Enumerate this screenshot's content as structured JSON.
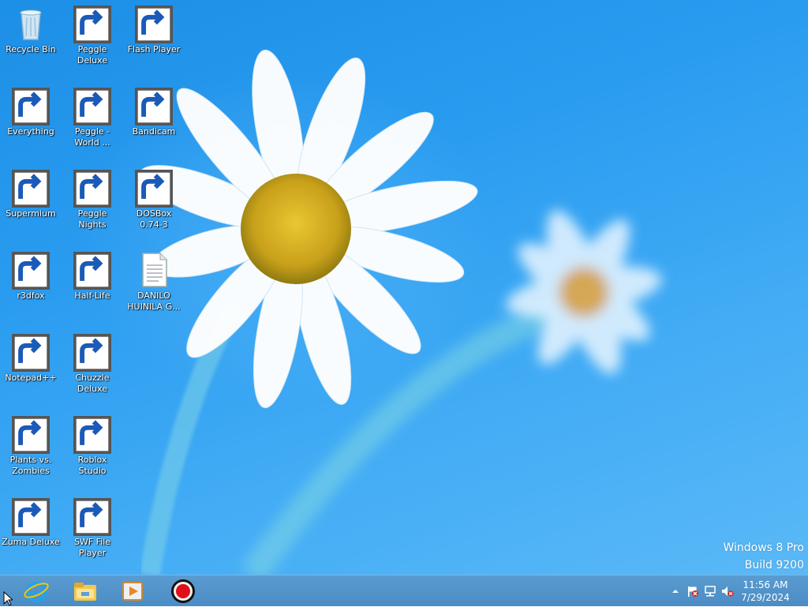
{
  "desktop": {
    "icons": [
      {
        "label": "Recycle Bin",
        "icon": "recycle-bin-icon",
        "shortcut": false
      },
      {
        "label": "Peggle Deluxe",
        "icon": "peggle-deluxe-icon",
        "shortcut": true
      },
      {
        "label": "Flash Player",
        "icon": "flash-player-icon",
        "shortcut": true
      },
      {
        "label": "Everything",
        "icon": "everything-icon",
        "shortcut": true
      },
      {
        "label": "Peggle - World ...",
        "icon": "peggle-world-icon",
        "shortcut": true
      },
      {
        "label": "Bandicam",
        "icon": "bandicam-icon",
        "shortcut": true
      },
      {
        "label": "Supermium",
        "icon": "supermium-icon",
        "shortcut": true
      },
      {
        "label": "Peggle Nights",
        "icon": "peggle-nights-icon",
        "shortcut": true
      },
      {
        "label": "DOSBox 0.74-3",
        "icon": "dosbox-icon",
        "shortcut": true
      },
      {
        "label": "r3dfox",
        "icon": "r3dfox-icon",
        "shortcut": true
      },
      {
        "label": "Half-Life",
        "icon": "half-life-icon",
        "shortcut": true
      },
      {
        "label": "DANILO HUINILA G...",
        "icon": "text-document-icon",
        "shortcut": false
      },
      {
        "label": "Notepad++",
        "icon": "notepad-plus-plus-icon",
        "shortcut": true
      },
      {
        "label": "Chuzzle Deluxe",
        "icon": "chuzzle-deluxe-icon",
        "shortcut": true
      },
      {
        "label": "Plants vs. Zombies",
        "icon": "plants-vs-zombies-icon",
        "shortcut": true
      },
      {
        "label": "Roblox Studio",
        "icon": "roblox-studio-icon",
        "shortcut": true
      },
      {
        "label": "Zuma Deluxe",
        "icon": "zuma-deluxe-icon",
        "shortcut": true
      },
      {
        "label": "SWF File Player",
        "icon": "swf-file-player-icon",
        "shortcut": true
      }
    ]
  },
  "watermark": {
    "line1": "Windows 8 Pro",
    "line2": "Build 9200"
  },
  "taskbar": {
    "pinned": [
      {
        "icon": "internet-explorer-icon"
      },
      {
        "icon": "file-explorer-icon"
      },
      {
        "icon": "media-player-icon"
      },
      {
        "icon": "bandicam-record-icon"
      }
    ],
    "tray": {
      "icons": [
        "show-hidden-icons-chevron",
        "action-center-flag-icon",
        "network-icon",
        "volume-muted-icon"
      ],
      "time": "11:56 AM",
      "date": "7/29/2024"
    }
  },
  "colors": {
    "wallpaper_top": "#1c8fe6",
    "wallpaper_bottom": "#5ab9f7",
    "taskbar": "#4a8cc4"
  }
}
